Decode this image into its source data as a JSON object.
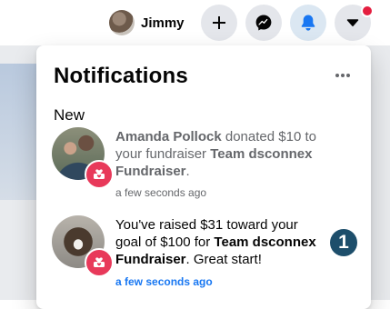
{
  "header": {
    "profile_name": "Jimmy",
    "notifications_has_badge": true
  },
  "panel": {
    "title": "Notifications",
    "section_label": "New",
    "items": [
      {
        "actor": "Amanda Pollock",
        "action": " donated $10 to your fundraiser ",
        "target": "Team dsconnex Fundraiser",
        "suffix": ".",
        "time": "a few seconds ago",
        "unread": false
      },
      {
        "prefix": "You've raised $31 toward your goal of $100 for ",
        "target": "Team dsconnex Fundraiser",
        "suffix": ". Great start!",
        "time": "a few seconds ago",
        "unread": true
      }
    ],
    "annotation_number": "1"
  },
  "colors": {
    "accent": "#1877f2",
    "badge_red": "#e41e3f",
    "fundraiser_pink": "#e8395a",
    "annotation": "#1d4e6b"
  }
}
